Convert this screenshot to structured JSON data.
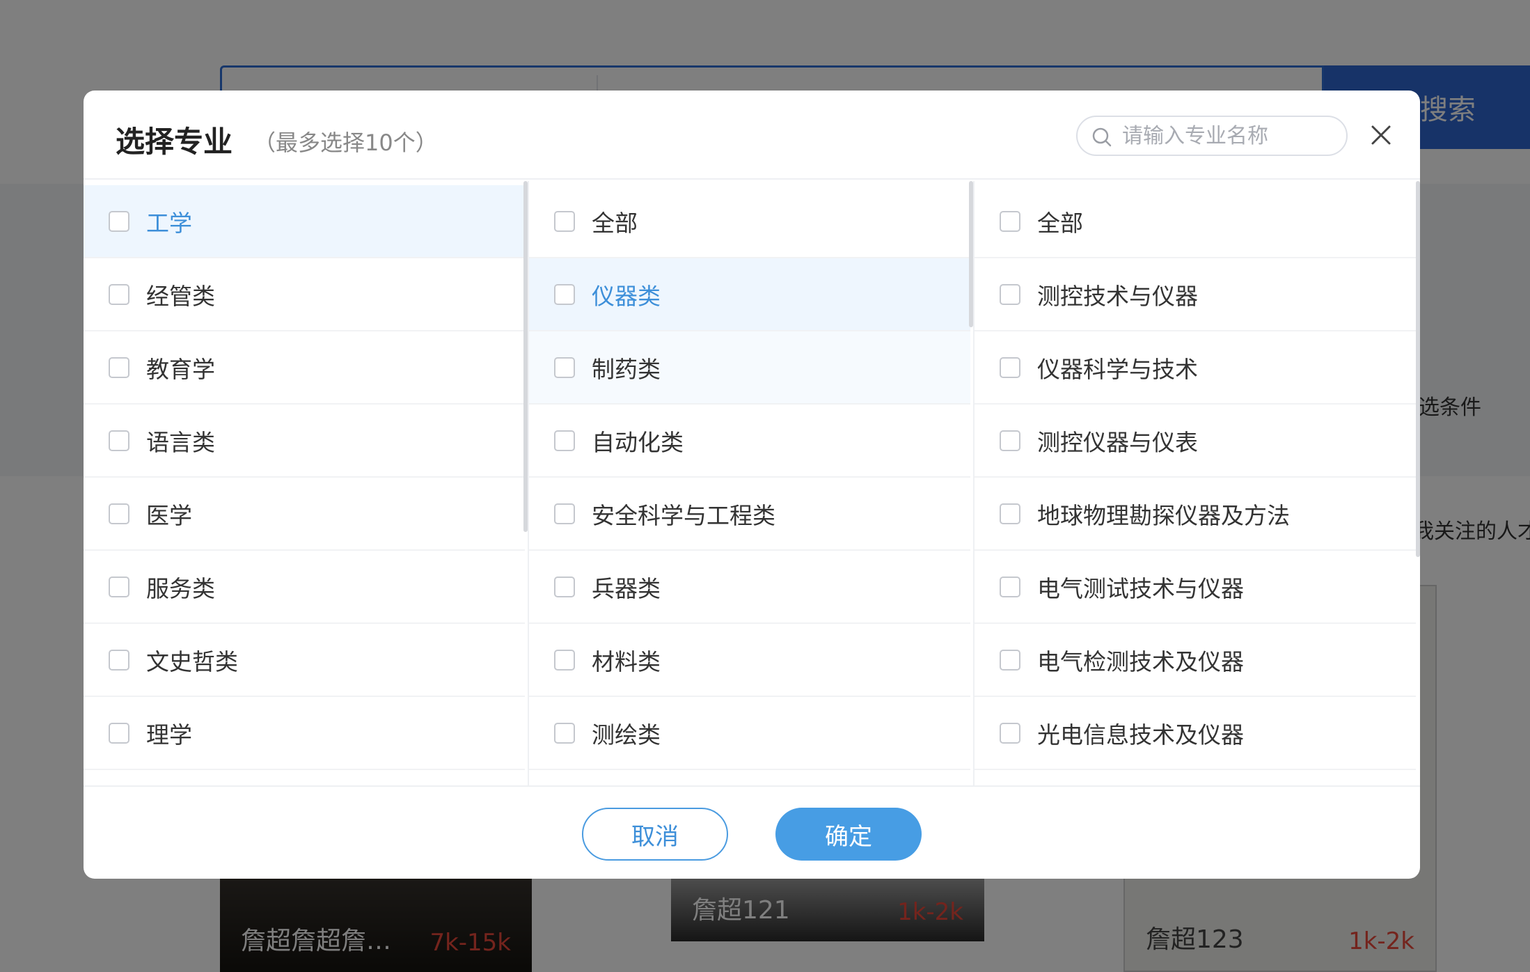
{
  "background": {
    "search_button_label": "搜索",
    "filter_text": "选条件",
    "follow_text": "我关注的人才",
    "cards": [
      {
        "title": "詹超詹超詹…",
        "salary": "7k-15k"
      },
      {
        "title": "詹超121",
        "salary": "1k-2k"
      },
      {
        "title": "詹超123",
        "salary": "1k-2k"
      }
    ]
  },
  "dialog": {
    "title": "选择专业",
    "subtitle": "（最多选择10个）",
    "search_placeholder": "请输入专业名称",
    "close_icon": "close-icon",
    "cancel_label": "取消",
    "ok_label": "确定",
    "column1": [
      {
        "label": "工学",
        "state": "active"
      },
      {
        "label": "经管类",
        "state": "normal"
      },
      {
        "label": "教育学",
        "state": "normal"
      },
      {
        "label": "语言类",
        "state": "normal"
      },
      {
        "label": "医学",
        "state": "normal"
      },
      {
        "label": "服务类",
        "state": "normal"
      },
      {
        "label": "文史哲类",
        "state": "normal"
      },
      {
        "label": "理学",
        "state": "normal"
      }
    ],
    "column2": [
      {
        "label": "全部",
        "state": "normal"
      },
      {
        "label": "仪器类",
        "state": "active"
      },
      {
        "label": "制药类",
        "state": "hover"
      },
      {
        "label": "自动化类",
        "state": "normal"
      },
      {
        "label": "安全科学与工程类",
        "state": "normal"
      },
      {
        "label": "兵器类",
        "state": "normal"
      },
      {
        "label": "材料类",
        "state": "normal"
      },
      {
        "label": "测绘类",
        "state": "normal"
      }
    ],
    "column3": [
      {
        "label": "全部",
        "state": "normal"
      },
      {
        "label": "测控技术与仪器",
        "state": "normal"
      },
      {
        "label": "仪器科学与技术",
        "state": "normal"
      },
      {
        "label": "测控仪器与仪表",
        "state": "normal"
      },
      {
        "label": "地球物理勘探仪器及方法",
        "state": "normal"
      },
      {
        "label": "电气测试技术与仪器",
        "state": "normal"
      },
      {
        "label": "电气检测技术及仪器",
        "state": "normal"
      },
      {
        "label": "光电信息技术及仪器",
        "state": "normal"
      }
    ]
  }
}
